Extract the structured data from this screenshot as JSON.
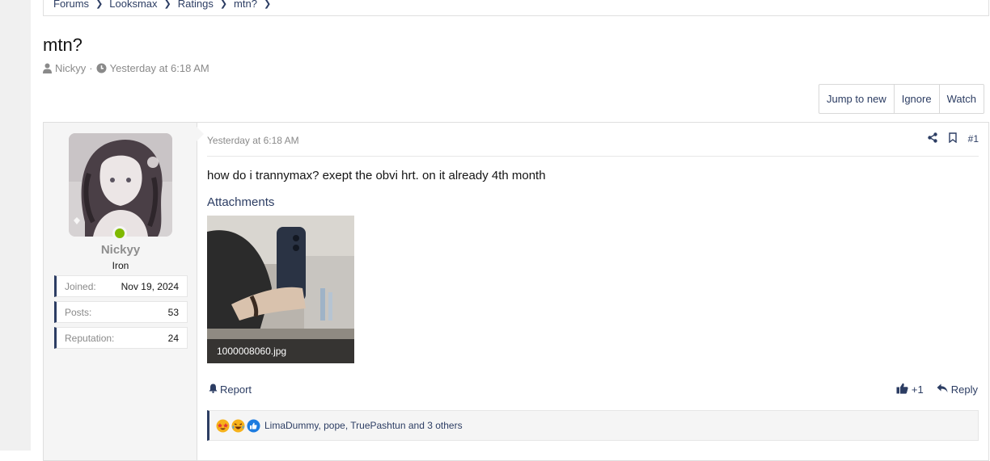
{
  "breadcrumb": [
    "Forums",
    "Looksmax",
    "Ratings",
    "mtn?"
  ],
  "thread": {
    "title": "mtn?",
    "author": "Nickyy",
    "separator": "·",
    "date": "Yesterday at 6:18 AM"
  },
  "actions": {
    "jump_to_new": "Jump to new",
    "ignore": "Ignore",
    "watch": "Watch"
  },
  "user": {
    "name": "Nickyy",
    "title": "Iron",
    "stats": [
      {
        "label": "Joined:",
        "value": "Nov 19, 2024"
      },
      {
        "label": "Posts:",
        "value": "53"
      },
      {
        "label": "Reputation:",
        "value": "24"
      }
    ]
  },
  "post": {
    "date": "Yesterday at 6:18 AM",
    "number": "#1",
    "body": "how do i trannymax? exept the obvi hrt. on it already 4th month",
    "attachments_heading": "Attachments",
    "attachment_name": "1000008060.jpg",
    "report_label": "Report",
    "like_count": "+1",
    "reply_label": "Reply",
    "reactions_text": "LimaDummy, pope, TruePashtun and 3 others"
  },
  "colors": {
    "link": "#2c3d63",
    "online": "#7fb900",
    "muted": "#8a8a8a"
  },
  "icons": [
    "user-icon",
    "clock-icon",
    "share-icon",
    "bookmark-icon",
    "bell-icon",
    "thumbs-up-icon",
    "reply-icon",
    "star-struck-emoji-icon",
    "laughing-emoji-icon",
    "like-reaction-icon"
  ]
}
